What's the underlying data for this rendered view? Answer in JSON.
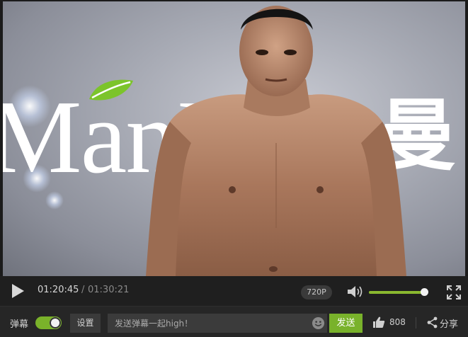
{
  "video": {
    "brand_text": "ManI",
    "brand_cn": "曼"
  },
  "controls": {
    "current_time": "01:20:45",
    "separator": "/",
    "total_time": "01:30:21",
    "quality": "720P",
    "volume_level": 0.98
  },
  "danmu": {
    "label": "弹幕",
    "toggle_on": true,
    "settings_label": "设置",
    "input_placeholder": "发送弹幕一起high！",
    "send_label": "发送",
    "like_count": "808",
    "share_label": "分享"
  },
  "colors": {
    "accent": "#7ab22a",
    "bar_bg": "#1f1f1f"
  },
  "icons": {
    "play": "play-icon",
    "volume": "volume-icon",
    "fullscreen": "fullscreen-icon",
    "emoji": "emoji-icon",
    "like": "thumbs-up-icon",
    "share": "share-icon"
  }
}
